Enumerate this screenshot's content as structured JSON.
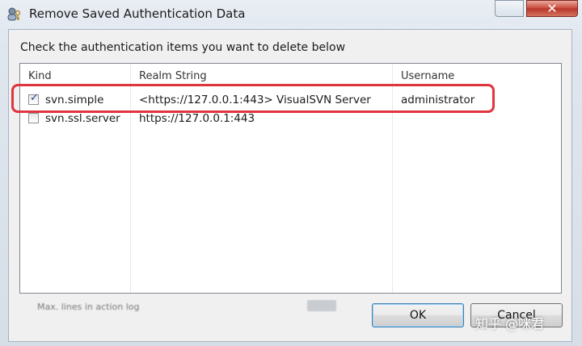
{
  "window": {
    "title": "Remove Saved Authentication Data",
    "close_glyph": "✕",
    "title_icon": "key-user-icon"
  },
  "dialog": {
    "instruction": "Check the authentication items you want to delete below",
    "columns": [
      "Kind",
      "Realm String",
      "Username"
    ],
    "rows": [
      {
        "checked": true,
        "kind": "svn.simple",
        "realm": "<https://127.0.0.1:443> VisualSVN Server",
        "username": "administrator"
      },
      {
        "checked": false,
        "kind": "svn.ssl.server",
        "realm": "https://127.0.0.1:443",
        "username": ""
      }
    ],
    "checkmark_glyph": "✓",
    "highlight_color": "#e0343f"
  },
  "buttons": {
    "ok": "OK",
    "cancel": "Cancel"
  },
  "background_status_text": "Max. lines in action log",
  "watermark": "知乎 @咪君"
}
